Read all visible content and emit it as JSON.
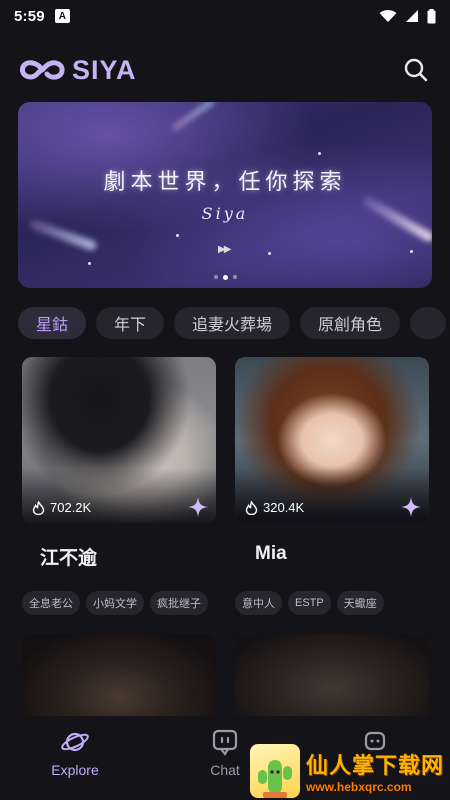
{
  "status_bar": {
    "time": "5:59",
    "app_badge": "A"
  },
  "header": {
    "logo_text": "SIYA"
  },
  "banner": {
    "title": "劇本世界，任你探索",
    "subtitle": "Siya",
    "active_dot": 2,
    "dot_count": 3
  },
  "tags": [
    {
      "label": "星鈷",
      "active": true
    },
    {
      "label": "年下",
      "active": false
    },
    {
      "label": "追妻火葬場",
      "active": false
    },
    {
      "label": "原創角色",
      "active": false
    },
    {
      "label": "",
      "active": false
    }
  ],
  "cards": [
    {
      "name": "江不逾",
      "stat": "702.2K",
      "tags": [
        "全息老公",
        "小妈文学",
        "疯批继子"
      ]
    },
    {
      "name": "Mia",
      "stat": "320.4K",
      "tags": [
        "意中人",
        "ESTP",
        "天蠍座"
      ]
    },
    {
      "name": "",
      "stat": "",
      "tags": []
    },
    {
      "name": "",
      "stat": "",
      "tags": []
    }
  ],
  "bottom_nav": [
    {
      "label": "Explore",
      "active": true
    },
    {
      "label": "Chat",
      "active": false
    },
    {
      "label": "",
      "active": false
    }
  ],
  "watermark": {
    "title": "仙人掌下载网",
    "url": "www.hebxqrc.com"
  },
  "colors": {
    "accent": "#b7a1f6",
    "background": "#141318",
    "chip": "#26252c"
  }
}
